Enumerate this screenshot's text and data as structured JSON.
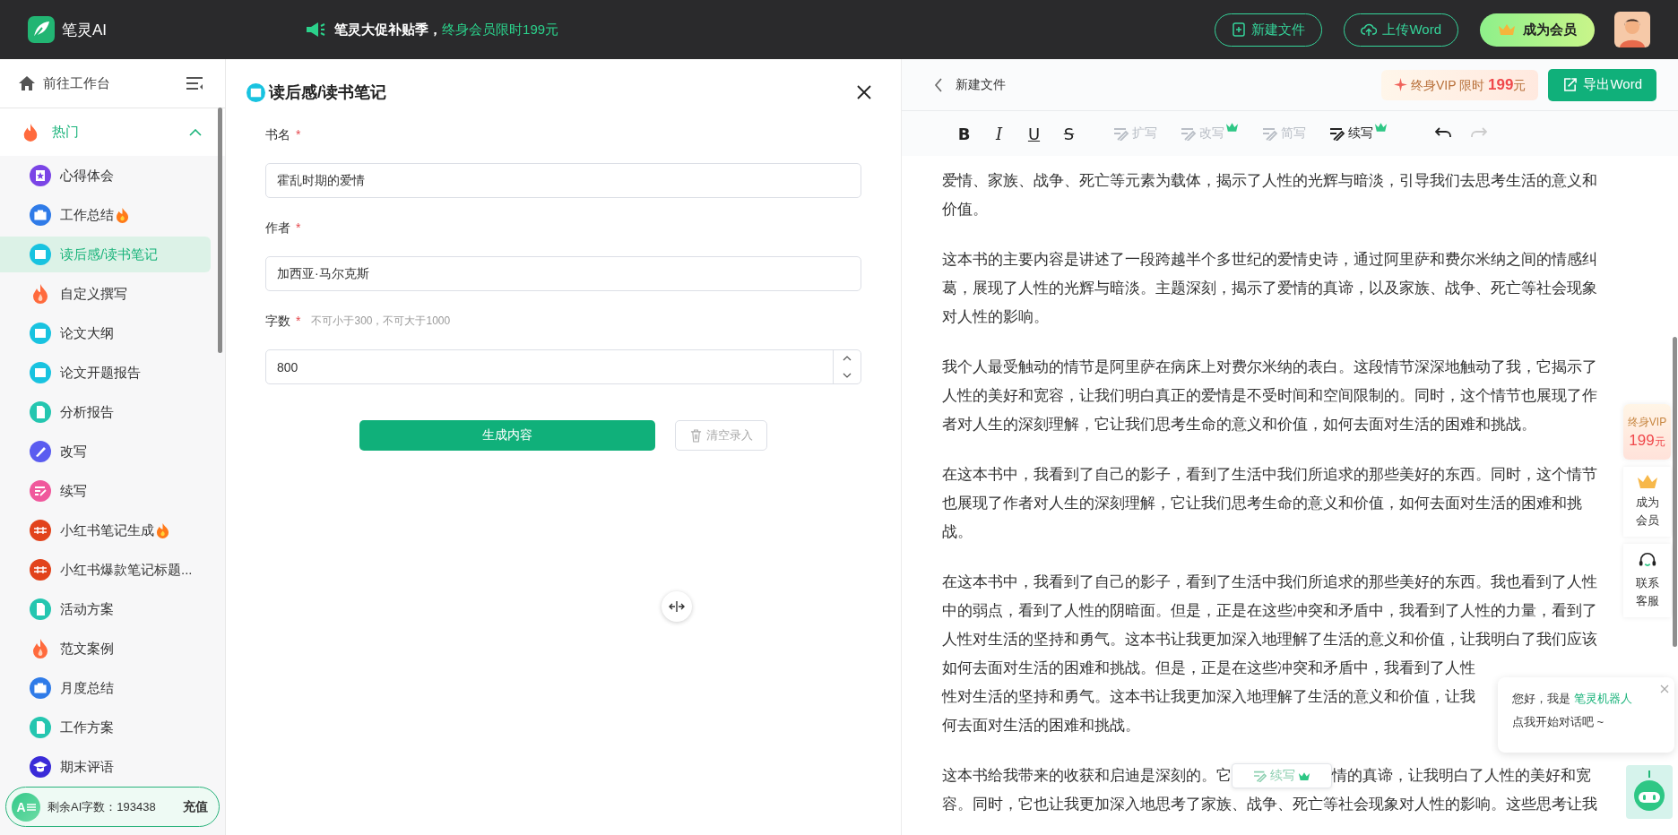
{
  "top_bar": {
    "brand": "笔灵AI",
    "promo": {
      "text": "笔灵大促补贴季，",
      "highlight": "终身会员限时199元"
    },
    "buttons": [
      {
        "label": "新建文件",
        "kind": "new"
      },
      {
        "label": "上传Word",
        "kind": "upload"
      },
      {
        "label": "成为会员",
        "kind": "vip"
      }
    ]
  },
  "sidebar": {
    "workspace_link": "前往工作台",
    "group": {
      "label": "热门",
      "expanded": true,
      "items": [
        {
          "label": "心得体会",
          "kind": "star",
          "color": "#7b45e6",
          "hot": false,
          "selected": false
        },
        {
          "label": "工作总结",
          "kind": "briefcase",
          "color": "#2f7be8",
          "hot": true,
          "selected": false
        },
        {
          "label": "读后感/读书笔记",
          "kind": "book",
          "color": "#19c3e0",
          "hot": false,
          "selected": true
        },
        {
          "label": "自定义撰写",
          "kind": "fire",
          "hot": false,
          "selected": false
        },
        {
          "label": "论文大纲",
          "kind": "book",
          "color": "#19c3e0",
          "hot": false,
          "selected": false
        },
        {
          "label": "论文开题报告",
          "kind": "book",
          "color": "#19c3e0",
          "hot": false,
          "selected": false
        },
        {
          "label": "分析报告",
          "kind": "doc",
          "color": "#25c6b0",
          "hot": false,
          "selected": false
        },
        {
          "label": "改写",
          "kind": "pen",
          "color": "#5a5cf0",
          "hot": false,
          "selected": false
        },
        {
          "label": "续写",
          "kind": "edit",
          "color": "#f0589c",
          "hot": false,
          "selected": false
        },
        {
          "label": "小红书笔记生成",
          "kind": "note",
          "color": "#e2431c",
          "hot": true,
          "selected": false
        },
        {
          "label": "小红书爆款笔记标题...",
          "kind": "note",
          "color": "#e2431c",
          "hot": false,
          "selected": false
        },
        {
          "label": "活动方案",
          "kind": "doc",
          "color": "#25c6b0",
          "hot": false,
          "selected": false
        },
        {
          "label": "范文案例",
          "kind": "fire",
          "hot": false,
          "selected": false
        },
        {
          "label": "月度总结",
          "kind": "briefcase",
          "color": "#2f7be8",
          "hot": false,
          "selected": false
        },
        {
          "label": "工作方案",
          "kind": "doc",
          "color": "#25c6b0",
          "hot": false,
          "selected": false
        },
        {
          "label": "期末评语",
          "kind": "grad",
          "color": "#3a2bd8",
          "hot": false,
          "selected": false
        }
      ]
    },
    "quota": {
      "logo": "A",
      "label": "剩余AI字数：",
      "value": "193438",
      "action": "充值"
    }
  },
  "form": {
    "title": "读后感/读书笔记",
    "fields": [
      {
        "label": "书名",
        "required_mark": "*",
        "kind": "text",
        "value": "霍乱时期的爱情"
      },
      {
        "label": "作者",
        "required_mark": "*",
        "kind": "text",
        "value": "加西亚·马尔克斯"
      },
      {
        "label": "字数",
        "required_mark": "*",
        "hint": "不可小于300，不可大于1000",
        "kind": "number",
        "value": "800"
      }
    ],
    "buttons": [
      {
        "label": "生成内容",
        "kind": "primary"
      },
      {
        "label": "清空录入",
        "kind": "clear"
      }
    ]
  },
  "editor": {
    "file_name": "新建文件",
    "promo": {
      "label": "终身VIP 限时",
      "price": "199",
      "unit": "元"
    },
    "export_button": "导出Word",
    "format_tools": [
      {
        "kind": "bold",
        "label": "B"
      },
      {
        "kind": "italic",
        "label": "I"
      },
      {
        "kind": "underline",
        "label": "U"
      },
      {
        "kind": "strike",
        "label": "S"
      }
    ],
    "ai_tools": [
      {
        "label": "扩写",
        "disabled": true,
        "vip": false
      },
      {
        "label": "改写",
        "disabled": true,
        "vip": true
      },
      {
        "label": "简写",
        "disabled": true,
        "vip": false
      },
      {
        "label": "续写",
        "disabled": false,
        "vip": true
      }
    ],
    "history": [
      {
        "kind": "undo",
        "disabled": false
      },
      {
        "kind": "redo",
        "disabled": true
      }
    ],
    "paragraphs": [
      {
        "lines": [
          [
            "爱情、家族、战争、死亡等元素为载体，揭示了人性的光辉与暗淡，引导我们去思考生活的意义和"
          ],
          [
            "价值。"
          ]
        ]
      },
      {
        "lines": [
          [
            "这本书的主要内容是讲述了一段跨越半个多世纪的爱情史诗，通过阿里萨和费尔米纳之间的情感纠"
          ],
          [
            "葛，展现了人性的光辉与暗淡。主题深刻，揭示了爱情的真谛，以及家族、战争、死亡等社会现象"
          ],
          [
            "对人性的影响。"
          ]
        ]
      },
      {
        "lines": [
          [
            "我个人最受触动的情节是阿里萨在病床上对费尔米纳的表白。这段情节深深地触动了我，它揭示了"
          ],
          [
            "人性的美好和宽容，让我们明白真正的爱情是不受时间和空间限制的。同时，这个情节也展现了作"
          ],
          [
            "者对人生的深刻理解，它让我们思考生命的意义和价值，如何去面对生活的困难和挑战。"
          ]
        ]
      },
      {
        "lines": [
          [
            "在这本书中，我看到了自己的影子，看到了生活中我们所追求的那些美好的东西。同时，这个情节"
          ],
          [
            "也展现了作者对人生的深刻理解，它让我们思考生命的意义和价值，如何去面对生活的困难和挑"
          ],
          [
            "战。"
          ]
        ]
      },
      {
        "lines": [
          [
            "在这本书中，我看到了自己的影子，看到了生活中我们所追求的那些美好的东西。我也看到了人性"
          ],
          [
            "中的弱点，看到了人性的阴暗面。但是，正是在这些冲突和矛盾中，我看到了人性的力量，看到了"
          ],
          [
            "人性对生活的坚持和勇气。这本书让我更加深入地理解了生活的意义和价值，让我明白了我们应该"
          ],
          [
            "如何去面对生活的困难和挑战。但是，正是在这些冲突和矛盾中，我看到了人性"
          ],
          [
            "性对生活的坚持和勇气。这本书让我更加深入地理解了生活的意义和价值，让我"
          ],
          [
            "何去面对生活的困难和挑战。"
          ]
        ]
      },
      {
        "lines": [
          [
            "这本书给我带来的收获和启迪是深刻的。它",
            "情的真谛，让我明白了人性的美好和宽"
          ],
          [
            "容。同时，它也让我更加深入地思考了家族、战争、死亡等社会现象对人性的影响。这些思考让我"
          ]
        ]
      }
    ],
    "float_button": {
      "label": "续写",
      "vip": true
    }
  },
  "side_float": [
    {
      "kind": "vip",
      "label": "终身VIP",
      "price": "199",
      "unit": "元"
    },
    {
      "kind": "member",
      "label": "成为会员"
    },
    {
      "kind": "service",
      "label": "联系客服"
    }
  ],
  "chat_bubble": {
    "greeting": "您好，我是",
    "bot_name": "笔灵机器人",
    "prompt": "点我开始对话吧 ~"
  }
}
